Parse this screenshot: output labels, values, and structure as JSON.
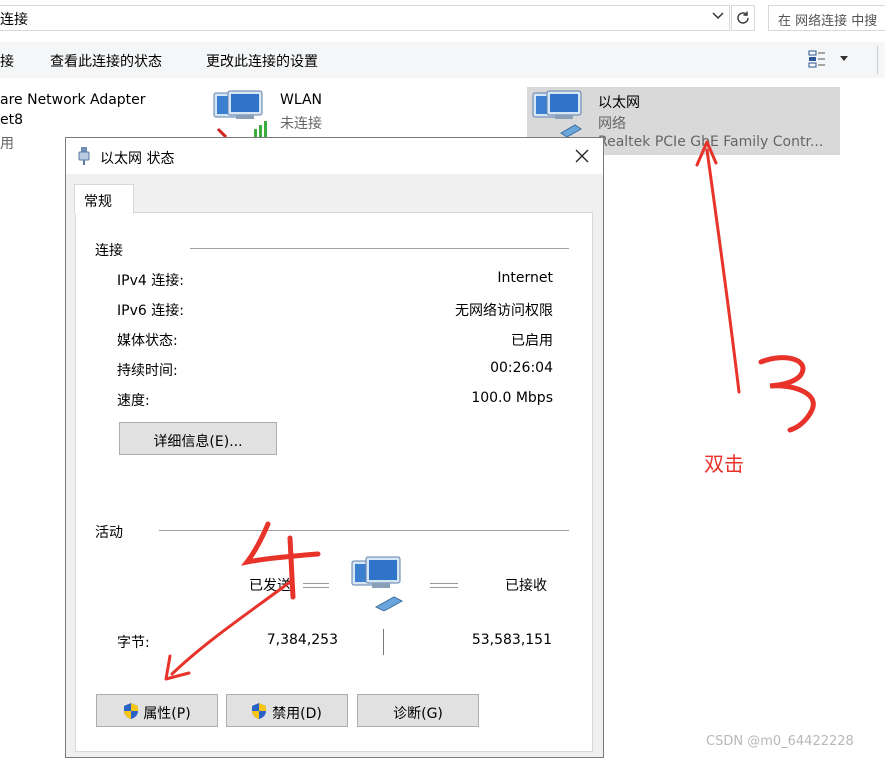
{
  "address_bar": {
    "path_text": "连接",
    "search_placeholder": "在 网络连接 中搜"
  },
  "command_bar": {
    "item0": "接",
    "item1": "查看此连接的状态",
    "item2": "更改此连接的设置"
  },
  "network_items": {
    "vmware": {
      "name": "are Network Adapter",
      "line2": "et8",
      "line3": "用"
    },
    "wlan": {
      "name": "WLAN",
      "status": "未连接"
    },
    "ethernet": {
      "name": "以太网",
      "status": "网络",
      "adapter": "Realtek PCIe GbE Family Contr..."
    }
  },
  "dialog": {
    "title": "以太网 状态",
    "tab_general": "常规",
    "connection_section": "连接",
    "rows": [
      {
        "label": "IPv4 连接:",
        "value": "Internet"
      },
      {
        "label": "IPv6 连接:",
        "value": "无网络访问权限"
      },
      {
        "label": "媒体状态:",
        "value": "已启用"
      },
      {
        "label": "持续时间:",
        "value": "00:26:04"
      },
      {
        "label": "速度:",
        "value": "100.0 Mbps"
      }
    ],
    "details_button": "详细信息(E)...",
    "activity_section": "活动",
    "sent_label": "已发送",
    "received_label": "已接收",
    "bytes_label": "字节:",
    "bytes_sent": "7,384,253",
    "bytes_received": "53,583,151",
    "properties_button": "属性(P)",
    "disable_button": "禁用(D)",
    "diagnose_button": "诊断(G)"
  },
  "annotations": {
    "step3": "3",
    "step4": "4",
    "double_click": "双击",
    "color": "#e8332a"
  },
  "watermark": "CSDN @m0_64422228"
}
